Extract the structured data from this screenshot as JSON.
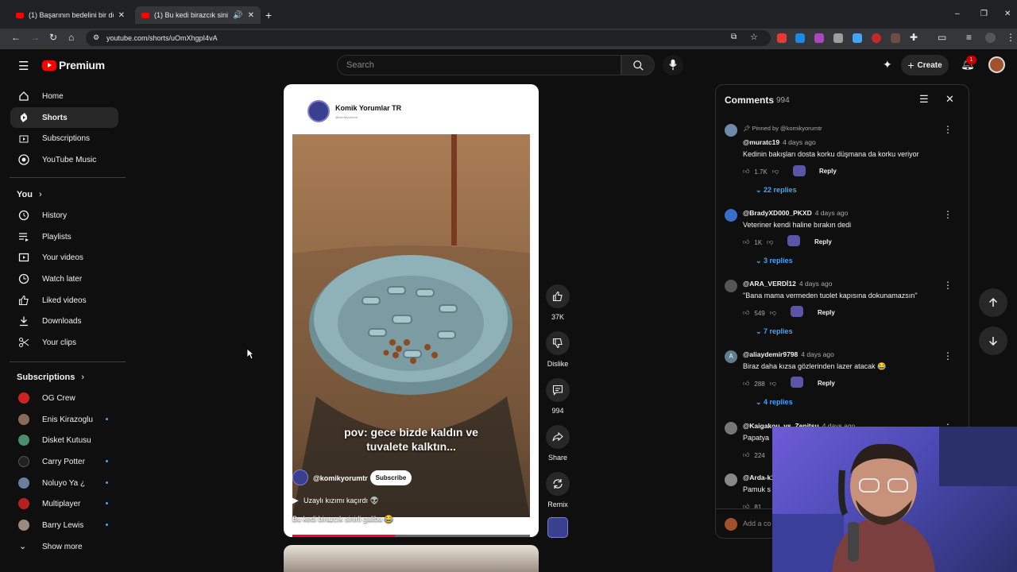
{
  "browser": {
    "tabs": [
      {
        "title": "(1) Başarının bedelini bir dönem"
      },
      {
        "title": "(1) Bu kedi birazcık sinirli g"
      }
    ],
    "url": "youtube.com/shorts/uOmXhgpI4vA",
    "new_tab": "+",
    "window_controls": [
      "–",
      "❐",
      "✕"
    ]
  },
  "youtube": {
    "logo_label": "Premium",
    "search_placeholder": "Search",
    "create_label": "Create",
    "notification_count": "1"
  },
  "sidebar": {
    "main": [
      {
        "label": "Home",
        "icon": "home-icon"
      },
      {
        "label": "Shorts",
        "icon": "shorts-icon",
        "selected": true
      },
      {
        "label": "Subscriptions",
        "icon": "subscriptions-icon"
      },
      {
        "label": "YouTube Music",
        "icon": "music-icon"
      }
    ],
    "you_label": "You",
    "you": [
      {
        "label": "History",
        "icon": "history-icon"
      },
      {
        "label": "Playlists",
        "icon": "playlists-icon"
      },
      {
        "label": "Your videos",
        "icon": "your-videos-icon"
      },
      {
        "label": "Watch later",
        "icon": "watch-later-icon"
      },
      {
        "label": "Liked videos",
        "icon": "like-icon"
      },
      {
        "label": "Downloads",
        "icon": "download-icon"
      },
      {
        "label": "Your clips",
        "icon": "clips-icon"
      }
    ],
    "subscriptions_label": "Subscriptions",
    "subscriptions": [
      {
        "label": "OG Crew",
        "color": "#cc2222",
        "dot": false
      },
      {
        "label": "Enis Kirazoglu",
        "color": "#8a6a55",
        "dot": true
      },
      {
        "label": "Disket Kutusu",
        "color": "#4a8f6a",
        "dot": false
      },
      {
        "label": "Carry Potter",
        "color": "#222222",
        "dot": true
      },
      {
        "label": "Noluyo Ya ¿",
        "color": "#6a7fa0",
        "dot": true
      },
      {
        "label": "Multiplayer",
        "color": "#b82020",
        "dot": true
      },
      {
        "label": "Barry Lewis",
        "color": "#9a8a80",
        "dot": true
      }
    ],
    "show_more": "Show more"
  },
  "short": {
    "channel_name": "Komik Yorumlar TR",
    "channel_handle": "@komikyorumtr",
    "overlay_text_1": "pov: gece bizde kaldın ve",
    "overlay_text_2": "tuvalete kalktın...",
    "bottom_handle": "@komikyorumtr",
    "subscribe_label": "Subscribe",
    "music_label": "Uzaylı kızımı kaçırdı 👽",
    "caption": "Bu kedi birazcık sinirli galiba 😂",
    "progress": 0.43
  },
  "actions": {
    "like_count": "37K",
    "dislike_label": "Dislike",
    "comment_count": "994",
    "share_label": "Share",
    "remix_label": "Remix"
  },
  "comments": {
    "title": "Comments",
    "count": "994",
    "add_placeholder": "Add a co",
    "items": [
      {
        "pinned": "Pinned by @komikyorumtr",
        "author": "@muratc19",
        "time": "4 days ago",
        "text": "Kedinin bakışları dosta korku düşmana da korku veriyor",
        "likes": "1.7K",
        "reply": "Reply",
        "replies": "22 replies"
      },
      {
        "author": "@BradyXD000_PKXD",
        "time": "4 days ago",
        "text": "Veteriner kendi haline bırakın dedi",
        "likes": "1K",
        "reply": "Reply",
        "replies": "3 replies"
      },
      {
        "author": "@ARA_VERDİ12",
        "time": "4 days ago",
        "text": "\"Bana mama vermeden tuolet kapısına dokunamazsın\"",
        "likes": "549",
        "reply": "Reply",
        "replies": "7 replies"
      },
      {
        "author": "@aliaydemir9798",
        "time": "4 days ago",
        "text": "Biraz daha kızsa gözlerinden lazer atacak 😂",
        "likes": "288",
        "reply": "Reply",
        "replies": "4 replies"
      },
      {
        "author": "@Kaigakou_vs_Zenitsu",
        "time": "4 days ago",
        "text": "Papatya",
        "likes": "224"
      },
      {
        "author": "@Arda-k1",
        "text": "Pamuk s",
        "likes": "81"
      }
    ]
  }
}
